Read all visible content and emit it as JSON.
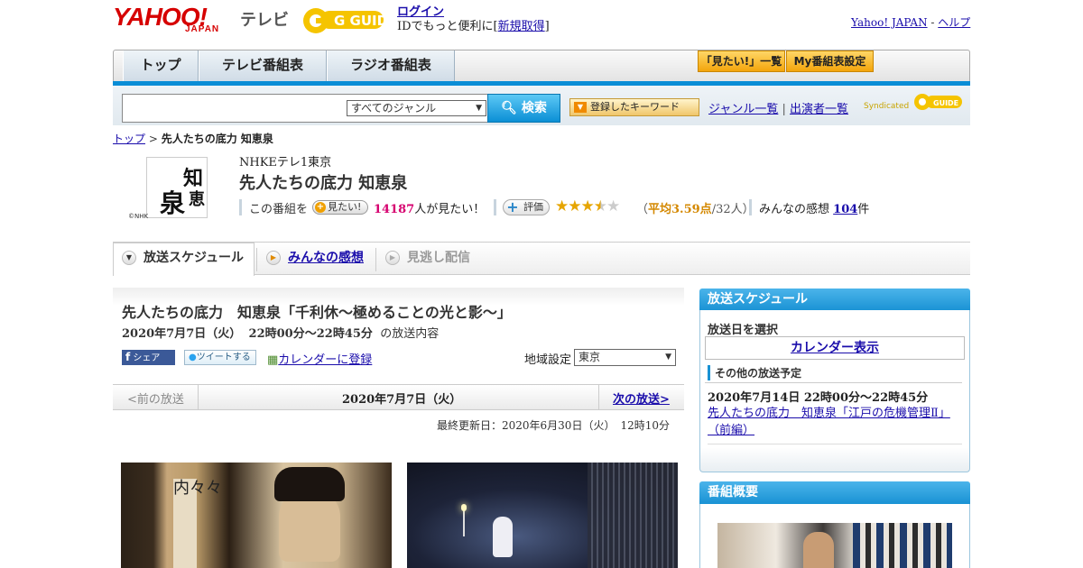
{
  "header": {
    "yahoo_logo": "YAHOO!",
    "japan_logo": "JAPAN",
    "tv_label": "テレビ",
    "gguide_logo": "G GUIDE",
    "login_link": "ログイン",
    "login_text": "IDでもっと便利に[",
    "signup_link": "新規取得",
    "login_text_end": "]",
    "yahoo_japan_link": "Yahoo! JAPAN",
    "separator": "-",
    "help_link": "ヘルプ"
  },
  "nav": {
    "tabs": [
      {
        "label": "トップ"
      },
      {
        "label": "テレビ番組表"
      },
      {
        "label": "ラジオ番組表"
      }
    ],
    "mitai_list_button": "「見たい!」一覧",
    "my_schedule_button": "My番組表設定"
  },
  "search": {
    "input_value": "",
    "genre_select": "すべてのジャンル",
    "search_button": "検索",
    "keyword_button": "登録したキーワード",
    "genre_list_link": "ジャンル一覧",
    "divider": "|",
    "performer_list_link": "出演者一覧",
    "syndicated_label": "Syndicated",
    "syndicated_logo": "G GUIDE"
  },
  "breadcrumb": {
    "top_link": "トップ",
    "sep": ">",
    "current": "先人たちの底力 知恵泉"
  },
  "program": {
    "image_text": "知恵泉",
    "image_credit": "©NHK",
    "channel": "NHKEテレ1東京",
    "title": "先人たちの底力 知恵泉",
    "mitai_prefix": "この番組を",
    "mitai_button": "見たい!",
    "mitai_count": "14187",
    "mitai_suffix": "人が見たい！",
    "rating_button": "評価",
    "rating_average": 3.59,
    "rating_open": "（",
    "rating_avg_text": "平均3.59点",
    "rating_count_text": "/32人）",
    "kansou_prefix": "みんなの感想",
    "kansou_count": "104",
    "kansou_suffix": "件"
  },
  "subtabs": [
    {
      "label": "放送スケジュール"
    },
    {
      "label": "みんなの感想"
    },
    {
      "label": "見逃し配信"
    }
  ],
  "episode": {
    "title": "先人たちの底力　知恵泉「千利休～極めることの光と影～」",
    "date": "2020年7月7日（火）",
    "time": "22時00分～22時45分",
    "suffix": "の放送内容",
    "facebook_button": "シェア",
    "tweet_button": "ツイートする",
    "calendar_link": "カレンダーに登録",
    "region_label": "地域設定",
    "region_value": "東京"
  },
  "pager": {
    "prev": "<前の放送",
    "current_date": "2020年7月7日（火）",
    "next": "次の放送>"
  },
  "updated": "最終更新日：2020年6月30日（火）　12時10分",
  "photos": {
    "photo1_text": "内々々"
  },
  "sidebar": {
    "schedule_title": "放送スケジュール",
    "select_date_label": "放送日を選択",
    "calendar_button": "カレンダー表示",
    "other_title": "その他の放送予定",
    "other_date": "2020年7月14日  22時00分～22時45分",
    "other_link": "先人たちの底力　知恵泉「江戸の危機管理Ⅱ」（前編）",
    "overview_title": "番組概要"
  }
}
